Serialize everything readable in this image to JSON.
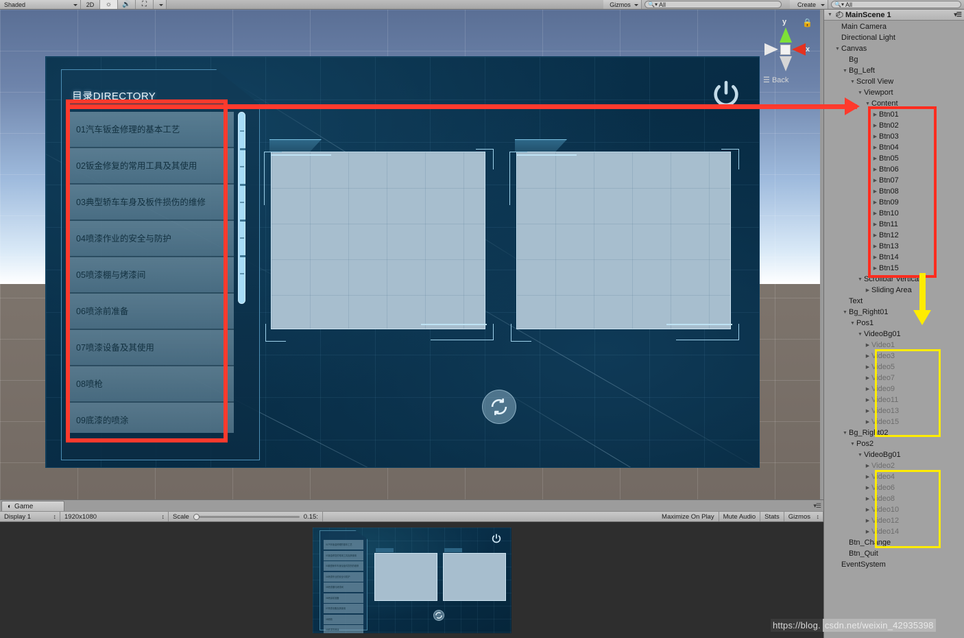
{
  "toolbar": {
    "draw_mode": "Shaded",
    "two_d": "2D",
    "lighting_icon": "sun-icon",
    "audio_icon": "speaker-icon",
    "effects_icon": "image-icon",
    "gizmos": "Gizmos",
    "search_value": "All",
    "create": "Create",
    "hierarchy_search_value": "All"
  },
  "scene": {
    "gizmo": {
      "x_label": "x",
      "y_label": "y",
      "view_label": "Back",
      "lock_icon": "lock-icon"
    }
  },
  "game_canvas": {
    "directory_title": "目录DIRECTORY",
    "items": [
      "01汽车钣金修理的基本工艺",
      "02钣金修复的常用工具及其使用",
      "03典型轿车车身及板件损伤的维修",
      "04喷漆作业的安全与防护",
      "05喷漆棚与烤漆间",
      "06喷涂前准备",
      "07喷漆设备及其使用",
      "08喷枪",
      "09底漆的喷涂"
    ],
    "power_icon": "power-icon",
    "swap_icon": "refresh-swap-icon",
    "scrollbar": "vertical-scrollbar"
  },
  "game_view": {
    "tab_label": "Game",
    "tab_icon": "unity-game-icon",
    "display": "Display 1",
    "resolution": "1920x1080",
    "scale_label": "Scale",
    "scale_value": "0.15:",
    "maximize_on_play": "Maximize On Play",
    "mute_audio": "Mute Audio",
    "stats": "Stats",
    "gizmos": "Gizmos"
  },
  "hierarchy": {
    "scene_name": "MainScene 1",
    "menu_icon": "hamburger-menu-icon",
    "rows": [
      {
        "label": "Main Camera",
        "indent": 1,
        "fold": "none",
        "dim": false
      },
      {
        "label": "Directional Light",
        "indent": 1,
        "fold": "none",
        "dim": false
      },
      {
        "label": "Canvas",
        "indent": 1,
        "fold": "open",
        "dim": false
      },
      {
        "label": "Bg",
        "indent": 2,
        "fold": "none",
        "dim": false
      },
      {
        "label": "Bg_Left",
        "indent": 2,
        "fold": "open",
        "dim": false
      },
      {
        "label": "Scroll View",
        "indent": 3,
        "fold": "open",
        "dim": false
      },
      {
        "label": "Viewport",
        "indent": 4,
        "fold": "open",
        "dim": false
      },
      {
        "label": "Content",
        "indent": 5,
        "fold": "open",
        "dim": false
      },
      {
        "label": "Btn01",
        "indent": 6,
        "fold": "closed",
        "dim": false
      },
      {
        "label": "Btn02",
        "indent": 6,
        "fold": "closed",
        "dim": false
      },
      {
        "label": "Btn03",
        "indent": 6,
        "fold": "closed",
        "dim": false
      },
      {
        "label": "Btn04",
        "indent": 6,
        "fold": "closed",
        "dim": false
      },
      {
        "label": "Btn05",
        "indent": 6,
        "fold": "closed",
        "dim": false
      },
      {
        "label": "Btn06",
        "indent": 6,
        "fold": "closed",
        "dim": false
      },
      {
        "label": "Btn07",
        "indent": 6,
        "fold": "closed",
        "dim": false
      },
      {
        "label": "Btn08",
        "indent": 6,
        "fold": "closed",
        "dim": false
      },
      {
        "label": "Btn09",
        "indent": 6,
        "fold": "closed",
        "dim": false
      },
      {
        "label": "Btn10",
        "indent": 6,
        "fold": "closed",
        "dim": false
      },
      {
        "label": "Btn11",
        "indent": 6,
        "fold": "closed",
        "dim": false
      },
      {
        "label": "Btn12",
        "indent": 6,
        "fold": "closed",
        "dim": false
      },
      {
        "label": "Btn13",
        "indent": 6,
        "fold": "closed",
        "dim": false
      },
      {
        "label": "Btn14",
        "indent": 6,
        "fold": "closed",
        "dim": false
      },
      {
        "label": "Btn15",
        "indent": 6,
        "fold": "closed",
        "dim": false
      },
      {
        "label": "Scrollbar Vertical",
        "indent": 4,
        "fold": "open",
        "dim": false
      },
      {
        "label": "Sliding Area",
        "indent": 5,
        "fold": "closed",
        "dim": false
      },
      {
        "label": "Text",
        "indent": 2,
        "fold": "none",
        "dim": false
      },
      {
        "label": "Bg_Right01",
        "indent": 2,
        "fold": "open",
        "dim": false
      },
      {
        "label": "Pos1",
        "indent": 3,
        "fold": "open",
        "dim": false
      },
      {
        "label": "VideoBg01",
        "indent": 4,
        "fold": "open",
        "dim": false
      },
      {
        "label": "Video1",
        "indent": 5,
        "fold": "closed",
        "dim": true
      },
      {
        "label": "Video3",
        "indent": 5,
        "fold": "closed",
        "dim": true
      },
      {
        "label": "Video5",
        "indent": 5,
        "fold": "closed",
        "dim": true
      },
      {
        "label": "Video7",
        "indent": 5,
        "fold": "closed",
        "dim": true
      },
      {
        "label": "Video9",
        "indent": 5,
        "fold": "closed",
        "dim": true
      },
      {
        "label": "Video11",
        "indent": 5,
        "fold": "closed",
        "dim": true
      },
      {
        "label": "Video13",
        "indent": 5,
        "fold": "closed",
        "dim": true
      },
      {
        "label": "Video15",
        "indent": 5,
        "fold": "closed",
        "dim": true
      },
      {
        "label": "Bg_Right02",
        "indent": 2,
        "fold": "open",
        "dim": false
      },
      {
        "label": "Pos2",
        "indent": 3,
        "fold": "open",
        "dim": false
      },
      {
        "label": "VideoBg01",
        "indent": 4,
        "fold": "open",
        "dim": false
      },
      {
        "label": "Video2",
        "indent": 5,
        "fold": "closed",
        "dim": true
      },
      {
        "label": "Video4",
        "indent": 5,
        "fold": "closed",
        "dim": true
      },
      {
        "label": "Video6",
        "indent": 5,
        "fold": "closed",
        "dim": true
      },
      {
        "label": "Video8",
        "indent": 5,
        "fold": "closed",
        "dim": true
      },
      {
        "label": "Video10",
        "indent": 5,
        "fold": "closed",
        "dim": true
      },
      {
        "label": "Video12",
        "indent": 5,
        "fold": "closed",
        "dim": true
      },
      {
        "label": "Video14",
        "indent": 5,
        "fold": "closed",
        "dim": true
      },
      {
        "label": "Btn_Change",
        "indent": 2,
        "fold": "none",
        "dim": false
      },
      {
        "label": "Btn_Quit",
        "indent": 2,
        "fold": "none",
        "dim": false
      },
      {
        "label": "EventSystem",
        "indent": 1,
        "fold": "none",
        "dim": false
      }
    ]
  },
  "annotations": {
    "red_color": "#ff3a2d",
    "yellow_color": "#ffec00",
    "watermark_dark": "https://blog.",
    "watermark_light": "csdn.net/weixin_42935398"
  }
}
